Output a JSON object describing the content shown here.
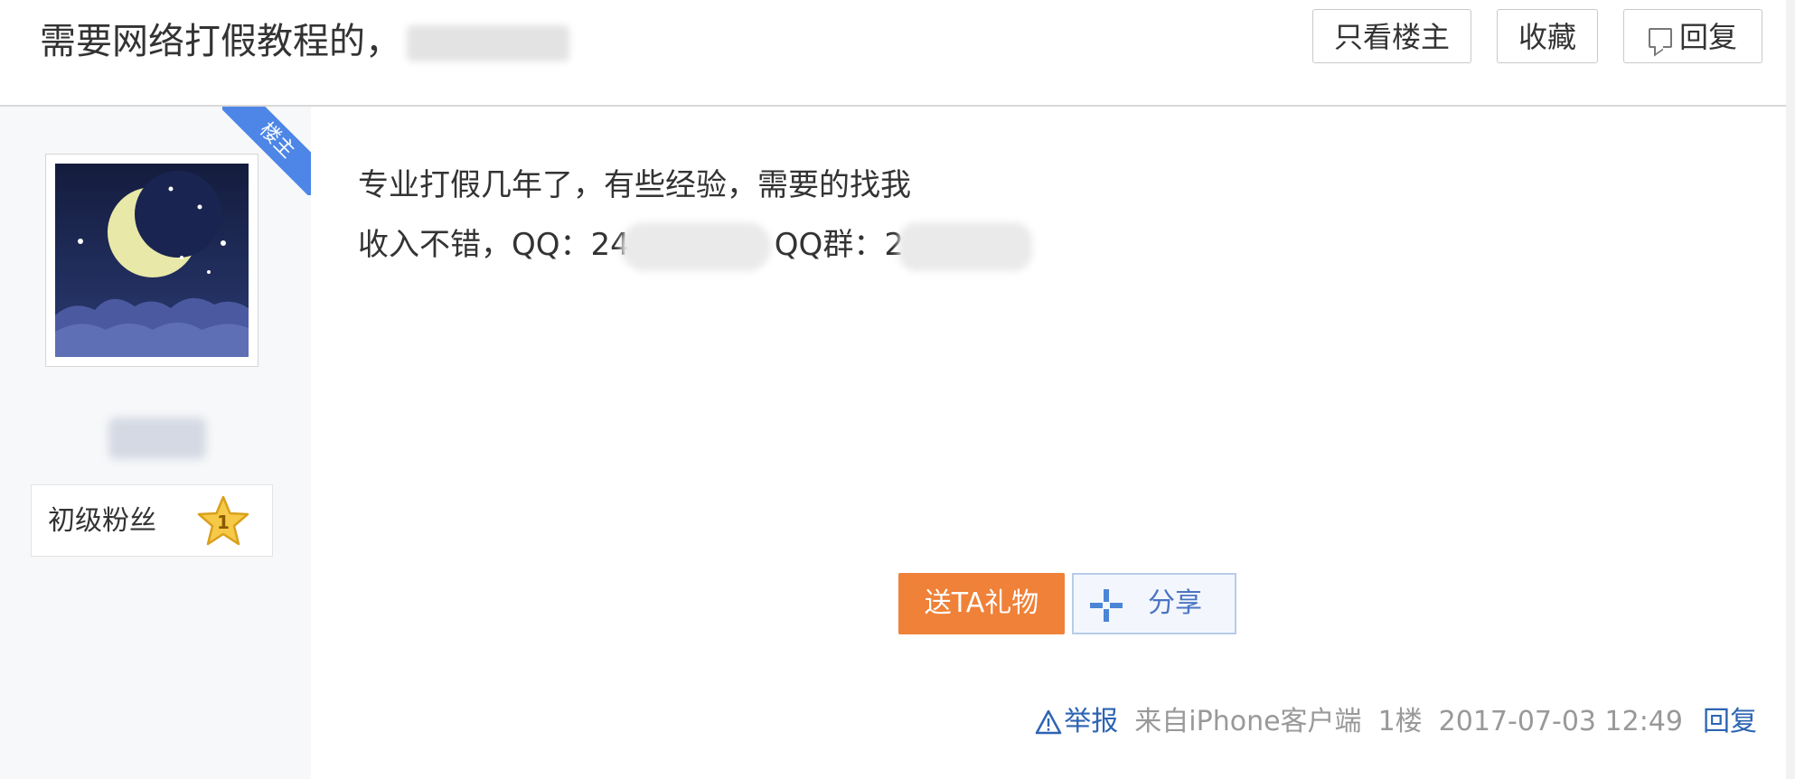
{
  "header": {
    "title": "需要网络打假教程的，",
    "buttons": {
      "only_op": "只看楼主",
      "favorite": "收藏",
      "reply": "回复"
    }
  },
  "author": {
    "badge": "楼主",
    "fan_level_label": "初级粉丝",
    "fan_level": "1",
    "avatar_icon": "moon-night-avatar"
  },
  "post": {
    "line1": "专业打假几年了，有些经验，需要的找我",
    "line2_prefix": "收入不错，QQ：24",
    "line2_group": "QQ群：2"
  },
  "actions": {
    "gift": "送TA礼物",
    "share": "分享"
  },
  "footer": {
    "report": "举报",
    "source": "来自iPhone客户端",
    "floor": "1楼",
    "timestamp": "2017-07-03 12:49",
    "reply": "回复"
  },
  "colors": {
    "accent_blue": "#2d64b3",
    "gift_orange": "#ef8138",
    "ribbon_blue": "#4d86e6"
  }
}
